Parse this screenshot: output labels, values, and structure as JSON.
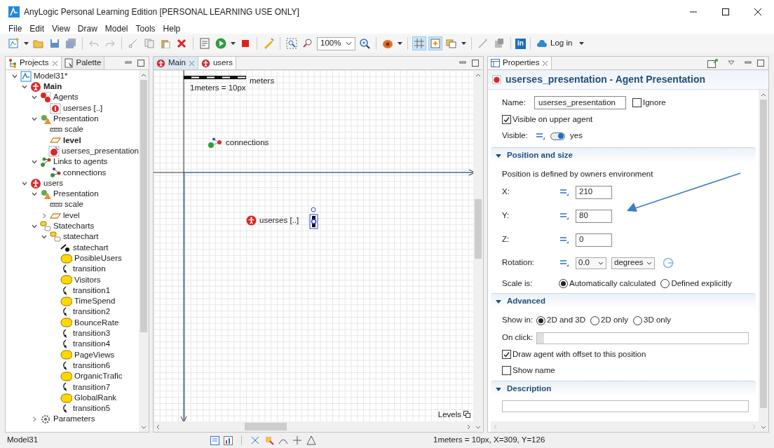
{
  "window": {
    "title": "AnyLogic Personal Learning Edition [PERSONAL LEARNING USE ONLY]"
  },
  "menu": [
    "File",
    "Edit",
    "View",
    "Draw",
    "Model",
    "Tools",
    "Help"
  ],
  "toolbar": {
    "zoom": "100%",
    "grid_toggle": {
      "selected": true
    },
    "snap_toggle": {
      "selected": true
    },
    "share_badge": "in",
    "login": "Log in"
  },
  "projects_panel": {
    "tabs": [
      {
        "label": "Projects",
        "selected": true
      },
      {
        "label": "Palette",
        "selected": false
      }
    ],
    "tree": [
      {
        "label": "Model31*",
        "kind": "model",
        "expanded": true,
        "children": [
          {
            "label": "Main",
            "kind": "agent",
            "bold": true,
            "expanded": true,
            "children": [
              {
                "label": "Agents",
                "kind": "agents",
                "bold": false,
                "expanded": true,
                "children": [
                  {
                    "label": "userses [..]",
                    "kind": "agent-population"
                  }
                ]
              },
              {
                "label": "Presentation",
                "kind": "presentation",
                "expanded": true,
                "children": [
                  {
                    "label": "scale",
                    "kind": "scale"
                  },
                  {
                    "label": "level",
                    "kind": "level",
                    "bold": true
                  },
                  {
                    "label": "userses_presentation",
                    "kind": "agent-presentation"
                  }
                ]
              },
              {
                "label": "Links to agents",
                "kind": "links",
                "expanded": true,
                "children": [
                  {
                    "label": "connections",
                    "kind": "connections"
                  }
                ]
              }
            ]
          },
          {
            "label": "users",
            "kind": "agent",
            "bold": false,
            "expanded": true,
            "children": [
              {
                "label": "Presentation",
                "kind": "presentation",
                "expanded": true,
                "children": [
                  {
                    "label": "scale",
                    "kind": "scale"
                  },
                  {
                    "label": "level",
                    "kind": "level",
                    "bold": false,
                    "expanded": false
                  }
                ]
              },
              {
                "label": "Statecharts",
                "kind": "statecharts",
                "expanded": true,
                "children": [
                  {
                    "label": "statechart",
                    "kind": "statecharts",
                    "expanded": true,
                    "children": [
                      {
                        "label": "statechart",
                        "kind": "entry"
                      },
                      {
                        "label": "PosibleUsers",
                        "kind": "state"
                      },
                      {
                        "label": "transition",
                        "kind": "transition"
                      },
                      {
                        "label": "Visitors",
                        "kind": "state"
                      },
                      {
                        "label": "transition1",
                        "kind": "transition"
                      },
                      {
                        "label": "TimeSpend",
                        "kind": "state"
                      },
                      {
                        "label": "transition2",
                        "kind": "transition"
                      },
                      {
                        "label": "BounceRate",
                        "kind": "state"
                      },
                      {
                        "label": "transition3",
                        "kind": "transition"
                      },
                      {
                        "label": "transition4",
                        "kind": "transition"
                      },
                      {
                        "label": "PageViews",
                        "kind": "state"
                      },
                      {
                        "label": "transition6",
                        "kind": "transition"
                      },
                      {
                        "label": "OrganicTrafic",
                        "kind": "state"
                      },
                      {
                        "label": "transition7",
                        "kind": "transition"
                      },
                      {
                        "label": "GlobalRank",
                        "kind": "state"
                      },
                      {
                        "label": "transition5",
                        "kind": "transition"
                      }
                    ]
                  }
                ]
              },
              {
                "label": "Parameters",
                "kind": "parameters",
                "expanded": false
              }
            ]
          }
        ]
      }
    ]
  },
  "editor": {
    "tabs": [
      {
        "label": "Main",
        "selected": true
      },
      {
        "label": "users",
        "selected": false
      }
    ],
    "scale_unit": "meters",
    "scale_label": "1meters = 10px",
    "elements": [
      {
        "kind": "connections",
        "label": "connections"
      },
      {
        "kind": "agent",
        "label": "userses [..]"
      }
    ],
    "levels": "Levels"
  },
  "properties": {
    "tab": "Properties",
    "heading": "userses_presentation - Agent Presentation",
    "name": {
      "label": "Name:",
      "value": "userses_presentation"
    },
    "ignore": {
      "label": "Ignore",
      "checked": false
    },
    "visible_upper": {
      "label": "Visible on upper agent",
      "checked": true
    },
    "visible": {
      "label": "Visible:",
      "on": true,
      "value": "yes"
    },
    "position": {
      "title": "Position and size",
      "expanded": true,
      "note": "Position is defined by owners environment",
      "fields": [
        {
          "label": "X:",
          "value": "210"
        },
        {
          "label": "Y:",
          "value": "80"
        },
        {
          "label": "Z:",
          "value": "0"
        }
      ],
      "rotation": {
        "label": "Rotation:",
        "value": "0.0",
        "unit": "degrees"
      },
      "scale": {
        "label": "Scale is:",
        "options": [
          {
            "label": "Automatically calculated",
            "selected": true
          },
          {
            "label": "Defined explicitly",
            "selected": false
          }
        ]
      }
    },
    "advanced": {
      "title": "Advanced",
      "expanded": true,
      "show_in": {
        "label": "Show in:",
        "options": [
          {
            "label": "2D and 3D",
            "selected": true
          },
          {
            "label": "2D only",
            "selected": false
          },
          {
            "label": "3D only",
            "selected": false
          }
        ]
      },
      "on_click": {
        "label": "On click:"
      },
      "checks": [
        {
          "label": "Draw agent with offset to this position",
          "checked": true
        },
        {
          "label": "Show name",
          "checked": false
        }
      ]
    },
    "description": {
      "title": "Description",
      "expanded": true
    }
  },
  "status_bar": {
    "left": "Model31",
    "right": "1meters = 10px, X=309, Y=126"
  }
}
